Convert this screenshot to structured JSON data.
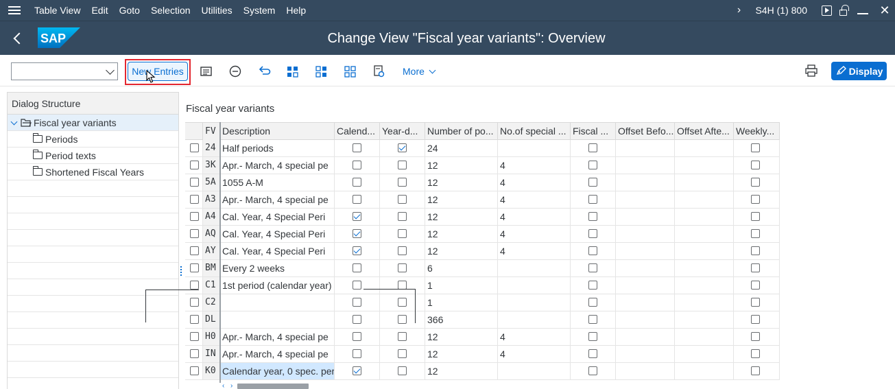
{
  "menubar": {
    "items": [
      "Table View",
      "Edit",
      "Goto",
      "Selection",
      "Utilities",
      "System",
      "Help"
    ],
    "system_info": "S4H (1) 800"
  },
  "titlebar": {
    "title": "Change View \"Fiscal year variants\": Overview",
    "logo_text": "SAP"
  },
  "toolbar": {
    "command_value": "",
    "new_entries_label": "New Entries",
    "more_label": "More",
    "display_label": "Display"
  },
  "dialog_structure": {
    "header": "Dialog Structure",
    "root": "Fiscal year variants",
    "children": [
      "Periods",
      "Period texts",
      "Shortened Fiscal Years"
    ]
  },
  "table": {
    "title": "Fiscal year variants",
    "columns": [
      "FV",
      "Description",
      "Calend...",
      "Year-d...",
      "Number of po...",
      "No.of special ...",
      "Fiscal ...",
      "Offset Befo...",
      "Offset Afte...",
      "Weekly..."
    ],
    "rows": [
      {
        "fv": "24",
        "desc": "Half periods",
        "cal": false,
        "yd": true,
        "num": "24",
        "spec": ""
      },
      {
        "fv": "3K",
        "desc": "Apr.- March, 4 special pe",
        "cal": false,
        "yd": false,
        "num": "12",
        "spec": "4"
      },
      {
        "fv": "5A",
        "desc": "1055 A-M",
        "cal": false,
        "yd": false,
        "num": "12",
        "spec": "4"
      },
      {
        "fv": "A3",
        "desc": "Apr.- March, 4 special pe",
        "cal": false,
        "yd": false,
        "num": "12",
        "spec": "4"
      },
      {
        "fv": "A4",
        "desc": "Cal. Year, 4 Special Peri",
        "cal": true,
        "yd": false,
        "num": "12",
        "spec": "4"
      },
      {
        "fv": "AQ",
        "desc": "Cal. Year, 4 Special Peri",
        "cal": true,
        "yd": false,
        "num": "12",
        "spec": "4"
      },
      {
        "fv": "AY",
        "desc": "Cal. Year, 4 Special Peri",
        "cal": true,
        "yd": false,
        "num": "12",
        "spec": "4"
      },
      {
        "fv": "BM",
        "desc": "Every 2 weeks",
        "cal": false,
        "yd": false,
        "num": "6",
        "spec": ""
      },
      {
        "fv": "C1",
        "desc": "1st period (calendar year)",
        "cal": false,
        "yd": false,
        "num": "1",
        "spec": ""
      },
      {
        "fv": "C2",
        "desc": "",
        "cal": false,
        "yd": false,
        "num": "1",
        "spec": ""
      },
      {
        "fv": "DL",
        "desc": "",
        "cal": false,
        "yd": false,
        "num": "366",
        "spec": ""
      },
      {
        "fv": "H0",
        "desc": "Apr.- March, 4 special pe",
        "cal": false,
        "yd": false,
        "num": "12",
        "spec": "4"
      },
      {
        "fv": "IN",
        "desc": "Apr.- March, 4 special pe",
        "cal": false,
        "yd": false,
        "num": "12",
        "spec": "4"
      },
      {
        "fv": "K0",
        "desc": "Calendar year, 0 spec. per",
        "cal": true,
        "yd": false,
        "num": "12",
        "spec": ""
      }
    ]
  },
  "colors": {
    "shell": "#354a5f",
    "accent": "#0a6ed1",
    "highlight": "#e3262f"
  }
}
